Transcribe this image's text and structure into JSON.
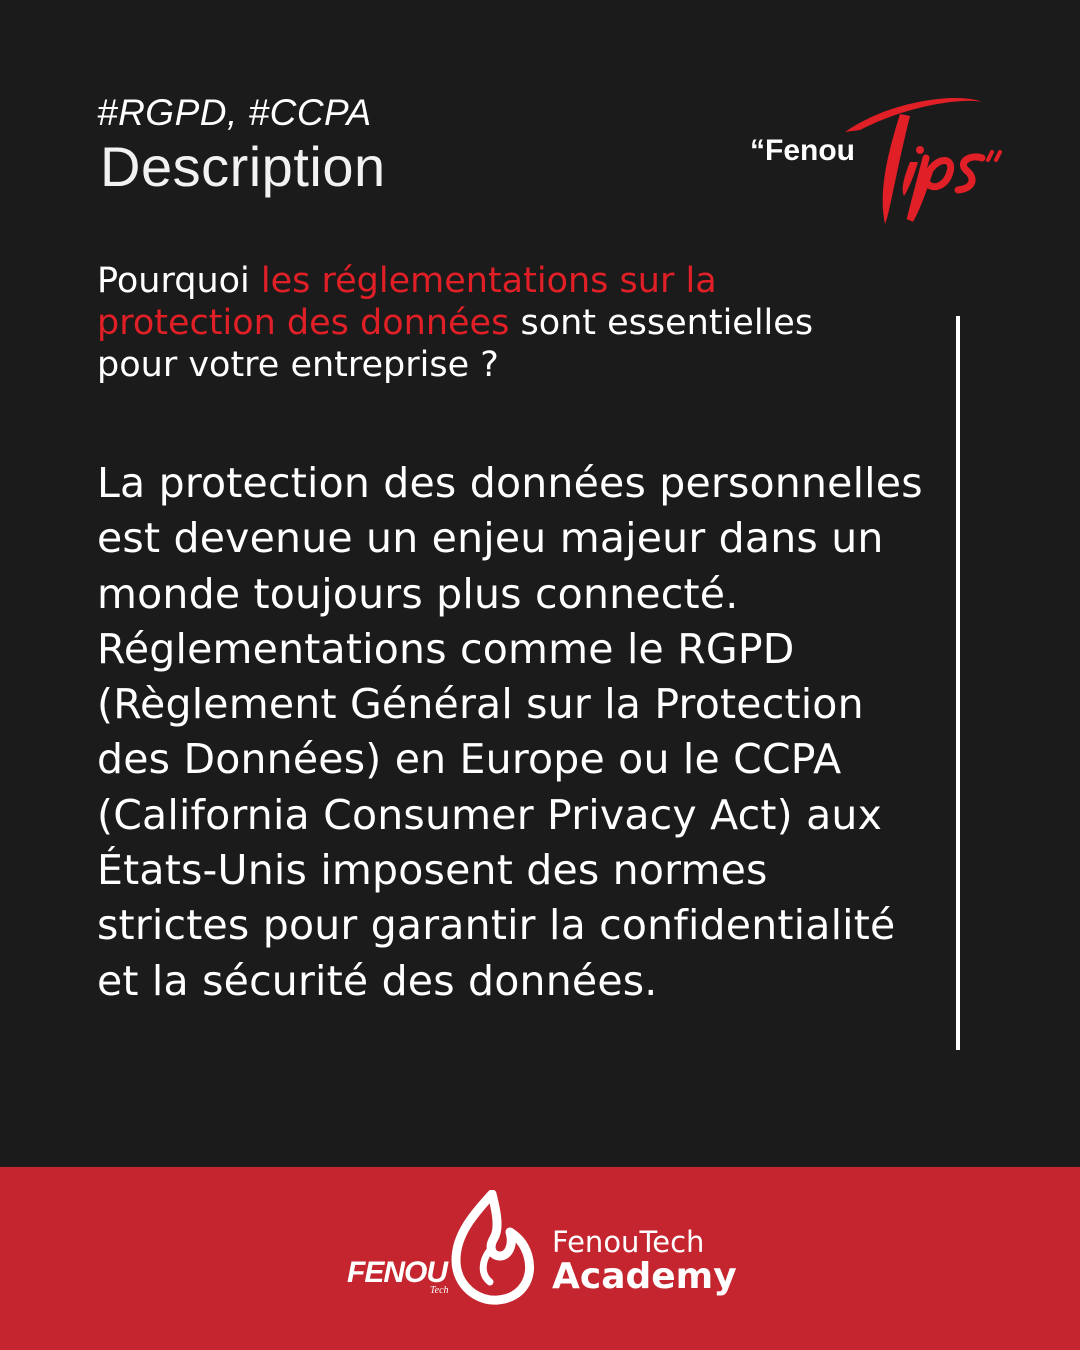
{
  "header": {
    "tags": "#RGPD, #CCPA",
    "title": "Description"
  },
  "brand_tips": {
    "word": "“Fenou",
    "script_word": "Tips",
    "accent_color": "#e01f26"
  },
  "question": {
    "part1": "Pourquoi ",
    "highlight": "les réglementations sur la protection des données",
    "part2": " sont essentielles pour votre entreprise ?"
  },
  "body": {
    "text": "La protection des données personnelles est devenue un enjeu majeur dans un monde toujours plus connecté. Réglementations comme le RGPD (Règlement Général sur la Protection des Données) en Europe ou le CCPA (California Consumer Privacy Act) aux États-Unis imposent des normes strictes pour garantir la confidentialité et la sécurité des données."
  },
  "footer": {
    "logo_word": "FENOU",
    "logo_sub": "Tech",
    "line1": "FenouTech",
    "line2": "Academy",
    "background": "#c4252e",
    "logo_icon": "flame-icon"
  }
}
